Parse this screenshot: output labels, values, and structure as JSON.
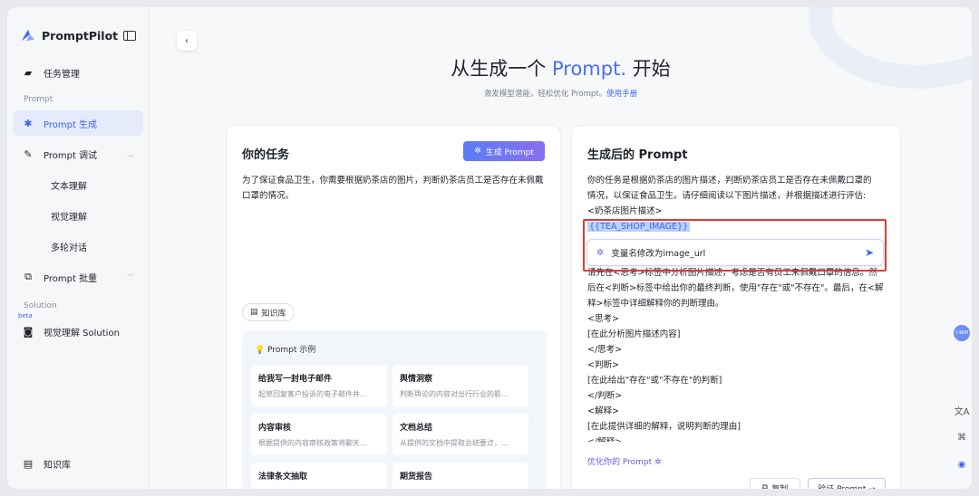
{
  "sidebar": {
    "logo": "PromptPilot",
    "items": [
      {
        "label": "任务管理",
        "icon": "folder-icon"
      },
      {
        "label": "Prompt 生成",
        "icon": "sparkle-user-icon"
      },
      {
        "label": "Prompt 调试",
        "icon": "debug-icon"
      },
      {
        "label": "Prompt 批量",
        "icon": "batch-icon"
      }
    ],
    "section_prompt": "Prompt",
    "sub_items": [
      "文本理解",
      "视觉理解",
      "多轮对话"
    ],
    "section_solution": "Solution",
    "solution_beta": "beta",
    "solution_item": "视觉理解 Solution",
    "bottom_item": "知识库"
  },
  "hero": {
    "title_pre": "从生成一个 ",
    "title_accent": "Prompt.",
    "title_post": " 开始",
    "subtitle": "激发模型潜能，轻松优化 Prompt。",
    "manual_link": "使用手册"
  },
  "task_card": {
    "title": "你的任务",
    "generate_button": "生成 Prompt",
    "task_text": "为了保证食品卫生，你需要根据奶茶店的图片，判断奶茶店员工是否存在未佩戴口罩的情况。",
    "kb_button": "知识库",
    "examples_title": "Prompt 示例",
    "examples": [
      {
        "title": "给我写一封电子邮件",
        "desc": "起草回复客户投诉的电子邮件并..."
      },
      {
        "title": "舆情洞察",
        "desc": "判断舆论的内容对出行行业的影..."
      },
      {
        "title": "内容审核",
        "desc": "根据提供的内容审核政策将聊天..."
      },
      {
        "title": "文档总结",
        "desc": "从提供的文档中提取总结要点，..."
      },
      {
        "title": "法律条文抽取",
        "desc": ""
      },
      {
        "title": "期货报告",
        "desc": ""
      }
    ]
  },
  "result_card": {
    "title": "生成后的 Prompt",
    "lines_before": [
      "你的任务是根据奶茶店的图片描述，判断奶茶店员工是否存在未佩戴口罩的",
      "情况，以保证食品卫生。请仔细阅读以下图片描述，并根据描述进行评估:",
      "<奶茶店图片描述>"
    ],
    "variable": "{{TEA_SHOP_IMAGE}}",
    "edit_value": "变量名修改为image_url",
    "lines_after": [
      "请先在<思考>标签中分析图片描述，考虑是否有员工未佩戴口罩的信息。然",
      "后在<判断>标签中给出你的最终判断，使用\"存在\"或\"不存在\"。最后，在<解",
      "释>标签中详细解释你的判断理由。",
      "<思考>",
      "[在此分析图片描述内容]",
      "</思考>",
      "<判断>",
      "[在此给出\"存在\"或\"不存在\"的判断]",
      "</判断>",
      "<解释>",
      "[在此提供详细的解释，说明判断的理由]",
      "</解释>"
    ],
    "optimize_link": "优化你的 Prompt",
    "copy_button": "复制",
    "verify_button": "验证 Prompt →"
  },
  "floating": {
    "badge": "148M"
  },
  "colors": {
    "accent": "#3c64f0",
    "highlight_box": "#e23b32"
  }
}
